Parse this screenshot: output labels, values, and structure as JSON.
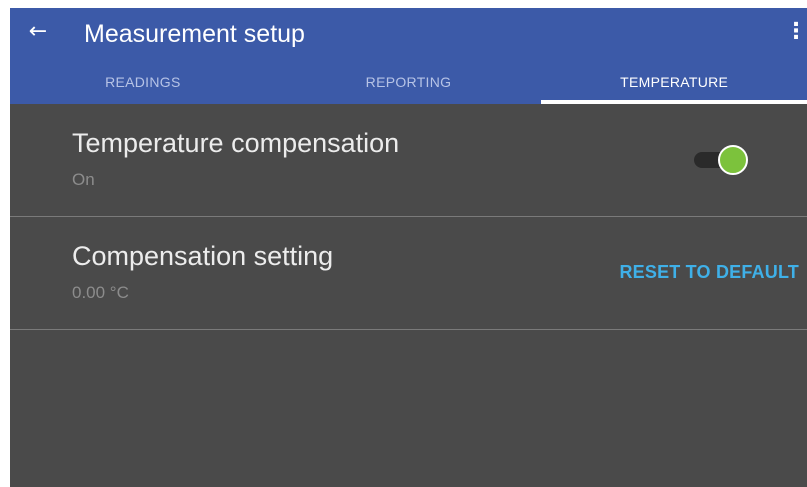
{
  "header": {
    "title": "Measurement setup",
    "back_icon": "arrow-left-icon",
    "overflow_icon": "more-vertical-icon"
  },
  "tabs": [
    {
      "label": "READINGS",
      "active": false
    },
    {
      "label": "REPORTING",
      "active": false
    },
    {
      "label": "TEMPERATURE",
      "active": true
    }
  ],
  "settings": [
    {
      "title": "Temperature compensation",
      "value": "On",
      "toggle_on": true
    },
    {
      "title": "Compensation setting",
      "value": "0.00 °C",
      "action_label": "RESET TO DEFAULT"
    }
  ],
  "colors": {
    "appbar": "#3c5aa8",
    "background": "#4a4a4a",
    "accent_green": "#7cc23c",
    "accent_blue": "#3fb0e8"
  }
}
